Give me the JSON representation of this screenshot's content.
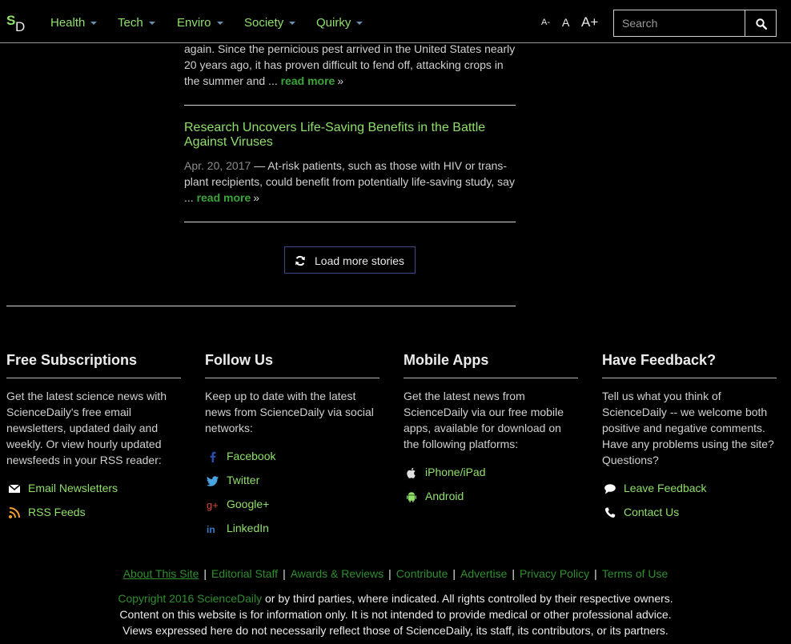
{
  "nav": {
    "logo_s": "S",
    "logo_d": "D",
    "items": [
      {
        "label": "Health"
      },
      {
        "label": "Tech"
      },
      {
        "label": "Enviro"
      },
      {
        "label": "Society"
      },
      {
        "label": "Quirky"
      }
    ],
    "font_small": "A-",
    "font_normal": "A",
    "font_large": "A+",
    "search_placeholder": "Search"
  },
  "stories": [
    {
      "summary_tail": "again. Since the pernicious pest arrived in the United States nearly 20 years ago, it has proven difficult to fend off, attacking crops in the summer and ...",
      "read_more": "read more",
      "arrow": "»"
    },
    {
      "title": "Research Uncovers Life-Saving Benefits in the Battle Against Viruses",
      "date": "Apr. 20, 2017",
      "summary": "— At-risk patients, such as those with HIV or trans-plant recipients, could benefit from potentially life-saving study, say ...",
      "read_more": "read more",
      "arrow": "»"
    }
  ],
  "load_more": "Load more stories",
  "footer_columns": [
    {
      "heading": "Free Subscriptions",
      "text": "Get the latest science news with ScienceDaily's free email newsletters, updated daily and weekly. Or view hourly updated newsfeeds in your RSS reader:",
      "links": [
        {
          "label": "Email Newsletters",
          "icon": "envelope-icon"
        },
        {
          "label": "RSS Feeds",
          "icon": "rss-icon"
        }
      ]
    },
    {
      "heading": "Follow Us",
      "text": "Keep up to date with the latest news from ScienceDaily via social networks:",
      "links": [
        {
          "label": "Facebook",
          "icon": "facebook-icon"
        },
        {
          "label": "Twitter",
          "icon": "twitter-icon"
        },
        {
          "label": "Google+",
          "icon": "google-plus-icon"
        },
        {
          "label": "LinkedIn",
          "icon": "linkedin-icon"
        }
      ]
    },
    {
      "heading": "Mobile Apps",
      "text": "Get the latest news from ScienceDaily via our free mobile apps, available for download on the following platforms:",
      "links": [
        {
          "label": "iPhone/iPad",
          "icon": "apple-icon"
        },
        {
          "label": "Android",
          "icon": "android-icon"
        }
      ]
    },
    {
      "heading": "Have Feedback?",
      "text": "Tell us what you think of ScienceDaily -- we welcome both positive and negative comments. Have any problems using the site? Questions?",
      "links": [
        {
          "label": "Leave Feedback",
          "icon": "comment-icon"
        },
        {
          "label": "Contact Us",
          "icon": "phone-icon"
        }
      ]
    }
  ],
  "footer_links": [
    "About This Site",
    "Editorial Staff",
    "Awards & Reviews",
    "Contribute",
    "Advertise",
    "Privacy Policy",
    "Terms of Use"
  ],
  "copyright": {
    "link": "Copyright 2016 ScienceDaily",
    "line1_rest": " or by third parties, where indicated. All rights controlled by their respective owners.",
    "line2": "Content on this website is for information only. It is not intended to provide medical or other professional advice.",
    "line3": "Views expressed here do not necessarily reflect those of ScienceDaily, its staff, its contributors, or its partners."
  },
  "colors": {
    "accent_green": "#8fe06a",
    "link_dark_green": "#2f8f2f",
    "background": "#000000"
  }
}
